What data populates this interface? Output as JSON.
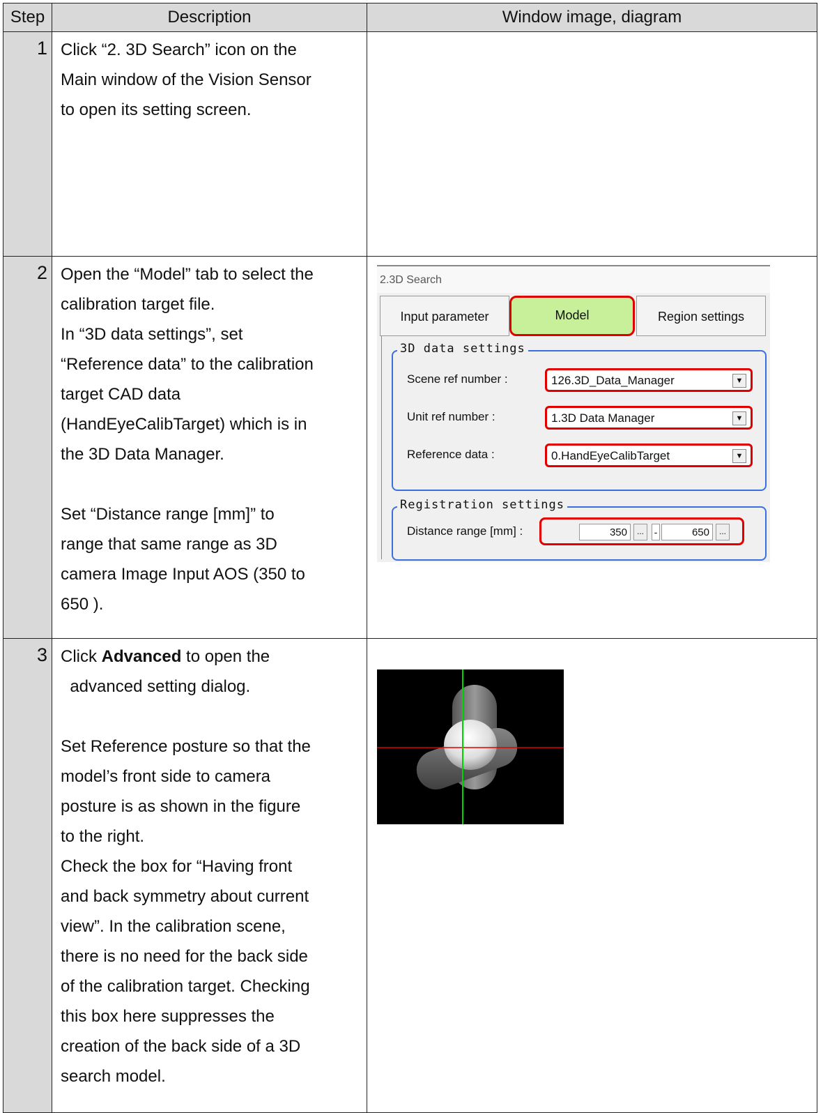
{
  "headers": {
    "step": "Step",
    "description": "Description",
    "image": "Window image, diagram"
  },
  "rows": [
    {
      "step": "1",
      "text": [
        "Click “2. 3D Search” icon on the",
        "Main window of the Vision Sensor",
        "to open its setting screen."
      ]
    },
    {
      "step": "2",
      "text": [
        "Open the “Model” tab to select the",
        "calibration target file.",
        "In “3D data settings”, set",
        "“Reference data” to the calibration",
        "target CAD data",
        "(HandEyeCalibTarget) which is in",
        "the 3D Data Manager."
      ],
      "text2": [
        "Set “Distance range [mm]” to",
        "range that same range as 3D",
        "camera Image Input AOS (350 to",
        "650 )."
      ]
    },
    {
      "step": "3",
      "text_pre": "Click ",
      "text_bold": "Advanced",
      "text_post": " to open the",
      "text": [
        "  advanced setting dialog."
      ],
      "text2": [
        "Set Reference posture so that the",
        "model’s front side to camera",
        "posture is as shown in the figure",
        "to the right.",
        "Check the box for “Having front",
        "and back symmetry about current",
        "view”. In the calibration scene,",
        "there is no need for the back side",
        "of the calibration target. Checking",
        "this box here suppresses the",
        "creation of the back side of a 3D",
        "search model."
      ]
    }
  ],
  "window": {
    "title": "2.3D Search",
    "tabs": [
      "Input parameter",
      "Model",
      "Region settings"
    ],
    "group1_title": "3D data settings",
    "scene_label": "Scene ref number :",
    "scene_value": "126.3D_Data_Manager",
    "unit_label": "Unit ref number :",
    "unit_value": "1.3D Data Manager",
    "ref_label": "Reference data :",
    "ref_value": "0.HandEyeCalibTarget",
    "group2_title": "Registration settings",
    "range_label": "Distance range [mm] :",
    "range_min": "350",
    "range_max": "650",
    "dots": "...",
    "dash": "-",
    "arrow": "▼"
  },
  "colors": {
    "highlight": "#e00000",
    "tab_active": "#c8f09b",
    "group_border": "#3a6fe0",
    "header_bg": "#d9d9d9"
  }
}
